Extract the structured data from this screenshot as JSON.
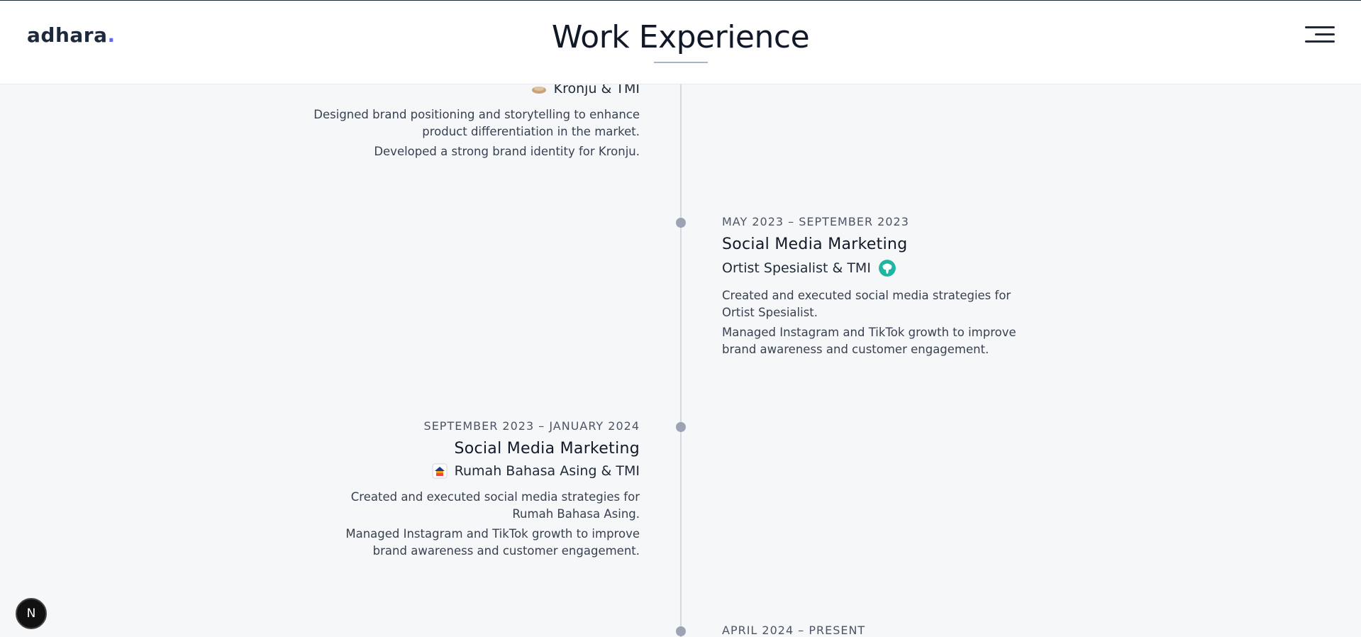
{
  "header": {
    "logo_text": "adhara",
    "logo_dot": ".",
    "title": "Work Experience"
  },
  "entries": [
    {
      "side": "left",
      "company": "Kronju & TMI",
      "company_logo_icon": "kronju-logo-icon",
      "desc": [
        "Designed brand positioning and storytelling to enhance product differentiation in the market.",
        "Developed a strong brand identity for Kronju."
      ]
    },
    {
      "side": "right",
      "date": "MAY 2023 – SEPTEMBER 2023",
      "role": "Social Media Marketing",
      "company": "Ortist Spesialist & TMI",
      "company_logo_icon": "ortist-logo-icon",
      "desc": [
        "Created and executed social media strategies for Ortist Spesialist.",
        "Managed Instagram and TikTok growth to improve brand awareness and customer engagement."
      ]
    },
    {
      "side": "left",
      "date": "SEPTEMBER 2023 – JANUARY 2024",
      "role": "Social Media Marketing",
      "company": "Rumah Bahasa Asing & TMI",
      "company_logo_icon": "rumah-bahasa-logo-icon",
      "desc": [
        "Created and executed social media strategies for Rumah Bahasa Asing.",
        "Managed Instagram and TikTok growth to improve brand awareness and customer engagement."
      ]
    },
    {
      "side": "right",
      "date": "APRIL 2024 – PRESENT"
    }
  ],
  "badge": {
    "label": "N"
  },
  "colors": {
    "accent": "#6366f1",
    "timeline": "#d4d7dd",
    "dot": "#9ca3b4",
    "background": "#f6f7f9"
  }
}
